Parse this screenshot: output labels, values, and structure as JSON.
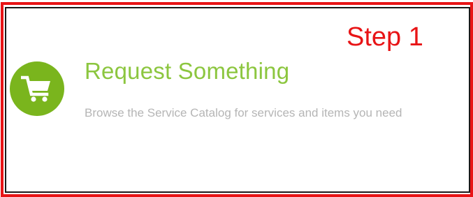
{
  "annotation": {
    "step_label": "Step 1",
    "color": "#e81416"
  },
  "card": {
    "icon": "shopping-cart-icon",
    "icon_bg_color": "#7ab51d",
    "title": "Request Something",
    "title_color": "#8cc63f",
    "description": "Browse the Service Catalog for services and items you need",
    "description_color": "#b5b5b5"
  }
}
